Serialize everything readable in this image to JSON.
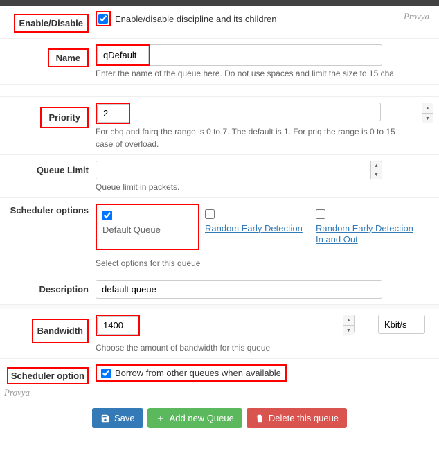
{
  "watermark": "Provya",
  "enable": {
    "label": "Enable/Disable",
    "desc": "Enable/disable discipline and its children"
  },
  "name": {
    "label": "Name",
    "value": "qDefault",
    "help": "Enter the name of the queue here. Do not use spaces and limit the size to 15 cha"
  },
  "priority": {
    "label": "Priority",
    "value": "2",
    "help": "For cbq and fairq the range is 0 to 7. The default is 1. For priq the range is 0 to 15",
    "help2": "case of overload."
  },
  "qlimit": {
    "label": "Queue Limit",
    "value": "",
    "help": "Queue limit in packets."
  },
  "sched": {
    "label": "Scheduler options",
    "opt1": "Default Queue",
    "opt2": "Random Early Detection",
    "opt3": "Random Early Detection In and Out",
    "help": "Select options for this queue"
  },
  "desc": {
    "label": "Description",
    "value": "default queue"
  },
  "bw": {
    "label": "Bandwidth",
    "value": "1400",
    "unit": "Kbit/s",
    "help": "Choose the amount of bandwidth for this queue"
  },
  "sched2": {
    "label": "Scheduler option",
    "desc": "Borrow from other queues when available"
  },
  "btns": {
    "save": "Save",
    "add": "Add new Queue",
    "del": "Delete this queue"
  }
}
